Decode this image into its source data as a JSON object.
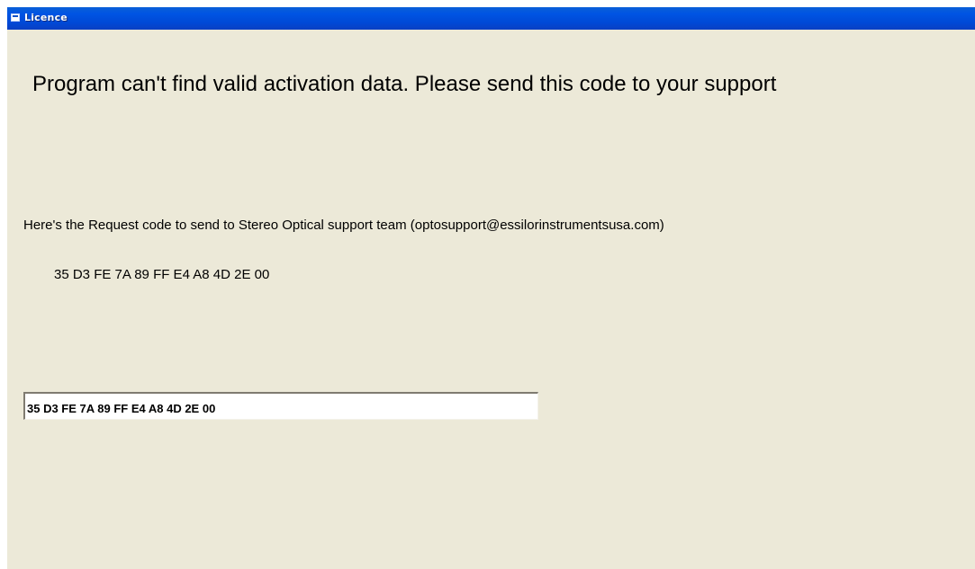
{
  "window": {
    "title": "Licence",
    "icon": "window-app-icon"
  },
  "main": {
    "headline": "Program can't find valid activation data. Please send this code to your support",
    "request_label": "Here's the Request code to send to Stereo Optical support team (optosupport@essilorinstrumentsusa.com)",
    "request_code": "35 D3 FE 7A 89 FF E4 A8 4D 2E 00",
    "code_field_value": "35 D3 FE 7A 89 FF E4 A8 4D 2E 00"
  },
  "colors": {
    "titlebar": "#0054e3",
    "window_background": "#ece9d8",
    "field_background": "#ffffff"
  }
}
